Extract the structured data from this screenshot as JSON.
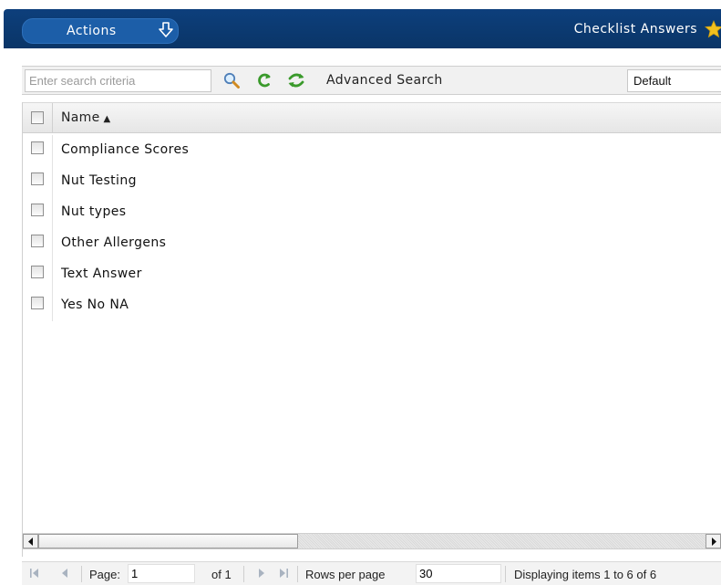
{
  "header": {
    "actions_label": "Actions",
    "actions_icon": "download-arrow-icon",
    "page_title": "Checklist Answers",
    "favorite_icon": "star-icon"
  },
  "toolbar": {
    "search_placeholder": "Enter search criteria",
    "search_icon": "magnifier-icon",
    "clear_icon": "clear-search-icon",
    "refresh_icon": "refresh-icon",
    "advanced_search_label": "Advanced Search",
    "view_select_value": "Default"
  },
  "grid": {
    "column_name": "Name",
    "sort_indicator": "▲",
    "rows": [
      "Compliance Scores",
      "Nut Testing",
      "Nut types",
      "Other Allergens",
      "Text Answer",
      "Yes No NA"
    ]
  },
  "pager": {
    "page_label": "Page:",
    "page_value": "1",
    "of_label": "of 1",
    "rows_per_page_label": "Rows per page",
    "rows_per_page_value": "30",
    "display_status": "Displaying items 1 to 6 of 6"
  },
  "colors": {
    "header_bar": "#0d3f7c",
    "actions_button": "#1c5ea8",
    "star": "#f2c01e",
    "refresh_green": "#3a9a2b"
  }
}
